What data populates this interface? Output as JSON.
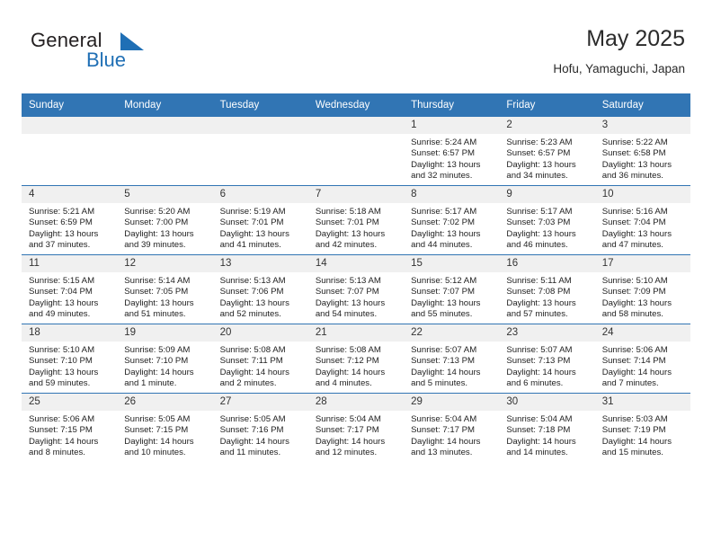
{
  "brand": {
    "word_one": "General",
    "word_two": "Blue",
    "flag_icon": "blue-flag-icon",
    "accent_color": "#1f6fb5"
  },
  "header": {
    "title": "May 2025",
    "subtitle": "Hofu, Yamaguchi, Japan"
  },
  "theme": {
    "header_blue": "#3175b4",
    "daynum_gray": "#f0f0f0"
  },
  "weekday_headers": [
    "Sunday",
    "Monday",
    "Tuesday",
    "Wednesday",
    "Thursday",
    "Friday",
    "Saturday"
  ],
  "labels": {
    "sunrise_prefix": "Sunrise:",
    "sunset_prefix": "Sunset:",
    "daylight_prefix": "Daylight:"
  },
  "weeks": [
    [
      {
        "day": "",
        "empty": true
      },
      {
        "day": "",
        "empty": true
      },
      {
        "day": "",
        "empty": true
      },
      {
        "day": "",
        "empty": true
      },
      {
        "day": "1",
        "sunrise": "Sunrise: 5:24 AM",
        "sunset": "Sunset: 6:57 PM",
        "daylight": "Daylight: 13 hours and 32 minutes."
      },
      {
        "day": "2",
        "sunrise": "Sunrise: 5:23 AM",
        "sunset": "Sunset: 6:57 PM",
        "daylight": "Daylight: 13 hours and 34 minutes."
      },
      {
        "day": "3",
        "sunrise": "Sunrise: 5:22 AM",
        "sunset": "Sunset: 6:58 PM",
        "daylight": "Daylight: 13 hours and 36 minutes."
      }
    ],
    [
      {
        "day": "4",
        "sunrise": "Sunrise: 5:21 AM",
        "sunset": "Sunset: 6:59 PM",
        "daylight": "Daylight: 13 hours and 37 minutes."
      },
      {
        "day": "5",
        "sunrise": "Sunrise: 5:20 AM",
        "sunset": "Sunset: 7:00 PM",
        "daylight": "Daylight: 13 hours and 39 minutes."
      },
      {
        "day": "6",
        "sunrise": "Sunrise: 5:19 AM",
        "sunset": "Sunset: 7:01 PM",
        "daylight": "Daylight: 13 hours and 41 minutes."
      },
      {
        "day": "7",
        "sunrise": "Sunrise: 5:18 AM",
        "sunset": "Sunset: 7:01 PM",
        "daylight": "Daylight: 13 hours and 42 minutes."
      },
      {
        "day": "8",
        "sunrise": "Sunrise: 5:17 AM",
        "sunset": "Sunset: 7:02 PM",
        "daylight": "Daylight: 13 hours and 44 minutes."
      },
      {
        "day": "9",
        "sunrise": "Sunrise: 5:17 AM",
        "sunset": "Sunset: 7:03 PM",
        "daylight": "Daylight: 13 hours and 46 minutes."
      },
      {
        "day": "10",
        "sunrise": "Sunrise: 5:16 AM",
        "sunset": "Sunset: 7:04 PM",
        "daylight": "Daylight: 13 hours and 47 minutes."
      }
    ],
    [
      {
        "day": "11",
        "sunrise": "Sunrise: 5:15 AM",
        "sunset": "Sunset: 7:04 PM",
        "daylight": "Daylight: 13 hours and 49 minutes."
      },
      {
        "day": "12",
        "sunrise": "Sunrise: 5:14 AM",
        "sunset": "Sunset: 7:05 PM",
        "daylight": "Daylight: 13 hours and 51 minutes."
      },
      {
        "day": "13",
        "sunrise": "Sunrise: 5:13 AM",
        "sunset": "Sunset: 7:06 PM",
        "daylight": "Daylight: 13 hours and 52 minutes."
      },
      {
        "day": "14",
        "sunrise": "Sunrise: 5:13 AM",
        "sunset": "Sunset: 7:07 PM",
        "daylight": "Daylight: 13 hours and 54 minutes."
      },
      {
        "day": "15",
        "sunrise": "Sunrise: 5:12 AM",
        "sunset": "Sunset: 7:07 PM",
        "daylight": "Daylight: 13 hours and 55 minutes."
      },
      {
        "day": "16",
        "sunrise": "Sunrise: 5:11 AM",
        "sunset": "Sunset: 7:08 PM",
        "daylight": "Daylight: 13 hours and 57 minutes."
      },
      {
        "day": "17",
        "sunrise": "Sunrise: 5:10 AM",
        "sunset": "Sunset: 7:09 PM",
        "daylight": "Daylight: 13 hours and 58 minutes."
      }
    ],
    [
      {
        "day": "18",
        "sunrise": "Sunrise: 5:10 AM",
        "sunset": "Sunset: 7:10 PM",
        "daylight": "Daylight: 13 hours and 59 minutes."
      },
      {
        "day": "19",
        "sunrise": "Sunrise: 5:09 AM",
        "sunset": "Sunset: 7:10 PM",
        "daylight": "Daylight: 14 hours and 1 minute."
      },
      {
        "day": "20",
        "sunrise": "Sunrise: 5:08 AM",
        "sunset": "Sunset: 7:11 PM",
        "daylight": "Daylight: 14 hours and 2 minutes."
      },
      {
        "day": "21",
        "sunrise": "Sunrise: 5:08 AM",
        "sunset": "Sunset: 7:12 PM",
        "daylight": "Daylight: 14 hours and 4 minutes."
      },
      {
        "day": "22",
        "sunrise": "Sunrise: 5:07 AM",
        "sunset": "Sunset: 7:13 PM",
        "daylight": "Daylight: 14 hours and 5 minutes."
      },
      {
        "day": "23",
        "sunrise": "Sunrise: 5:07 AM",
        "sunset": "Sunset: 7:13 PM",
        "daylight": "Daylight: 14 hours and 6 minutes."
      },
      {
        "day": "24",
        "sunrise": "Sunrise: 5:06 AM",
        "sunset": "Sunset: 7:14 PM",
        "daylight": "Daylight: 14 hours and 7 minutes."
      }
    ],
    [
      {
        "day": "25",
        "sunrise": "Sunrise: 5:06 AM",
        "sunset": "Sunset: 7:15 PM",
        "daylight": "Daylight: 14 hours and 8 minutes."
      },
      {
        "day": "26",
        "sunrise": "Sunrise: 5:05 AM",
        "sunset": "Sunset: 7:15 PM",
        "daylight": "Daylight: 14 hours and 10 minutes."
      },
      {
        "day": "27",
        "sunrise": "Sunrise: 5:05 AM",
        "sunset": "Sunset: 7:16 PM",
        "daylight": "Daylight: 14 hours and 11 minutes."
      },
      {
        "day": "28",
        "sunrise": "Sunrise: 5:04 AM",
        "sunset": "Sunset: 7:17 PM",
        "daylight": "Daylight: 14 hours and 12 minutes."
      },
      {
        "day": "29",
        "sunrise": "Sunrise: 5:04 AM",
        "sunset": "Sunset: 7:17 PM",
        "daylight": "Daylight: 14 hours and 13 minutes."
      },
      {
        "day": "30",
        "sunrise": "Sunrise: 5:04 AM",
        "sunset": "Sunset: 7:18 PM",
        "daylight": "Daylight: 14 hours and 14 minutes."
      },
      {
        "day": "31",
        "sunrise": "Sunrise: 5:03 AM",
        "sunset": "Sunset: 7:19 PM",
        "daylight": "Daylight: 14 hours and 15 minutes."
      }
    ]
  ]
}
